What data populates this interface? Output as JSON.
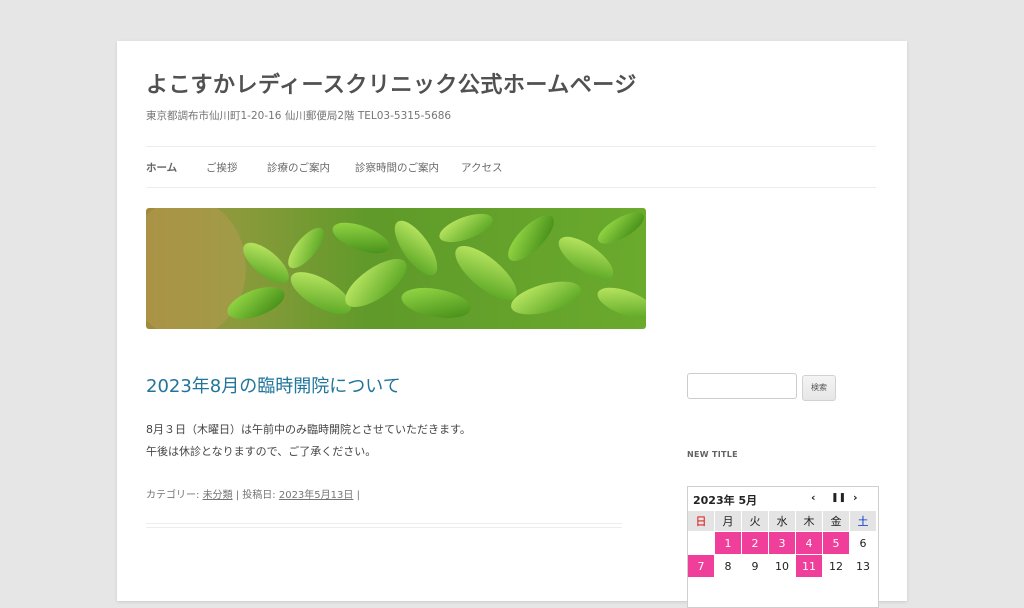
{
  "site": {
    "title": "よこすかレディースクリニック公式ホームページ",
    "description": "東京都調布市仙川町1-20-16 仙川郵便局2階 TEL03-5315-5686"
  },
  "nav": {
    "items": [
      {
        "label": "ホーム",
        "current": true
      },
      {
        "label": "ご挨拶"
      },
      {
        "label": "診療のご案内"
      },
      {
        "label": "診察時間のご案内"
      },
      {
        "label": "アクセス"
      }
    ]
  },
  "banner": {
    "image": "green-tea-leaves"
  },
  "post": {
    "title": "2023年8月の臨時開院について",
    "lines": [
      "8月３日（木曜日）は午前中のみ臨時開院とさせていただきます。",
      "午後は休診となりますので、ご了承ください。"
    ],
    "meta": {
      "category_label": "カテゴリー: ",
      "category": "未分類",
      "sep1": " | 投稿日: ",
      "date": "2023年5月13日",
      "sep2": " |"
    }
  },
  "sidebar": {
    "search": {
      "placeholder": "",
      "button_label": "検索"
    },
    "widget_title": "NEW TITLE",
    "calendar": {
      "month_label": "2023年 5月",
      "prev_icon": "chevron-left-icon",
      "pause_icon": "pause-icon",
      "next_icon": "chevron-right-icon",
      "weekdays": [
        "日",
        "月",
        "火",
        "水",
        "木",
        "金",
        "土"
      ],
      "weeks": [
        [
          "",
          "1",
          "2",
          "3",
          "4",
          "5",
          "6"
        ],
        [
          "7",
          "8",
          "9",
          "10",
          "11",
          "12",
          "13"
        ]
      ],
      "closed_days": [
        "1",
        "2",
        "3",
        "4",
        "5",
        "7",
        "11"
      ],
      "closed_color": "#f03e9b"
    }
  },
  "colors": {
    "link": "#21759b",
    "page_bg": "#e6e6e6"
  }
}
